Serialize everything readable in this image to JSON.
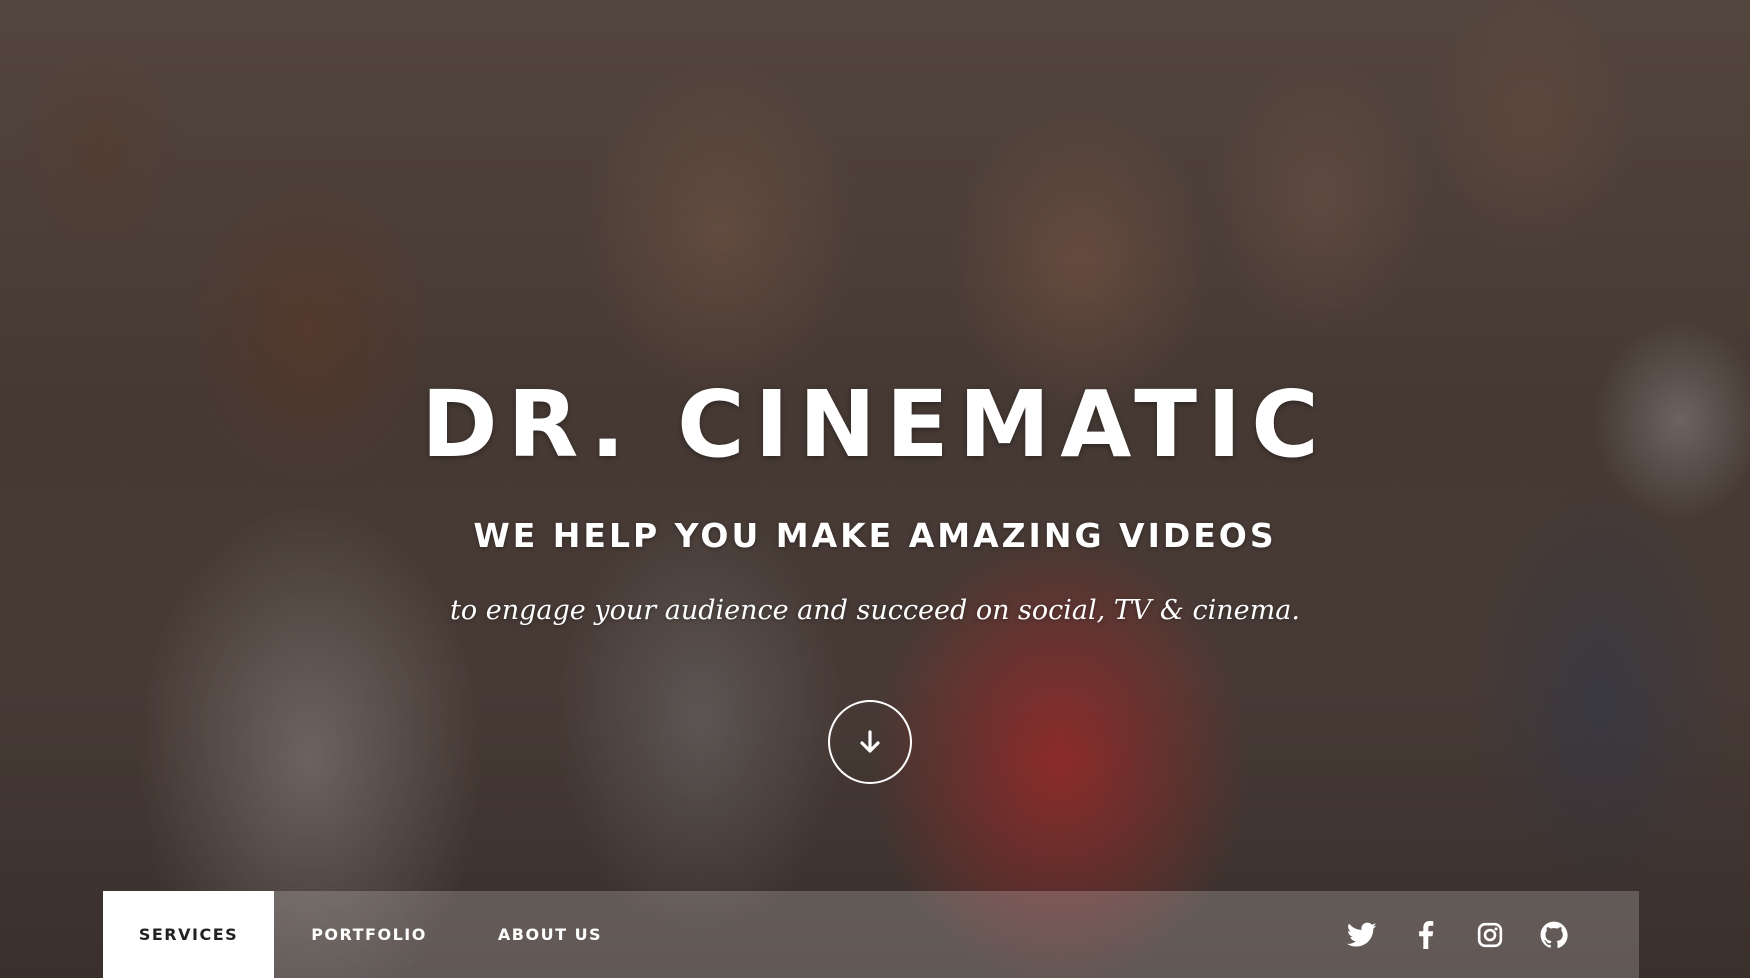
{
  "hero": {
    "title": "DR. CINEMATIC",
    "tagline": "WE HELP YOU MAKE AMAZING VIDEOS",
    "subtitle": "to engage your audience and succeed on social, TV & cinema.",
    "scroll_icon": "arrow-down-icon"
  },
  "nav": {
    "items": [
      {
        "label": "SERVICES",
        "active": true
      },
      {
        "label": "PORTFOLIO",
        "active": false
      },
      {
        "label": "ABOUT US",
        "active": false
      }
    ],
    "social": [
      {
        "icon": "twitter-icon"
      },
      {
        "icon": "facebook-icon"
      },
      {
        "icon": "instagram-icon"
      },
      {
        "icon": "github-icon"
      }
    ]
  },
  "colors": {
    "text": "#ffffff",
    "nav_active_bg": "#ffffff",
    "nav_active_text": "#222222"
  }
}
